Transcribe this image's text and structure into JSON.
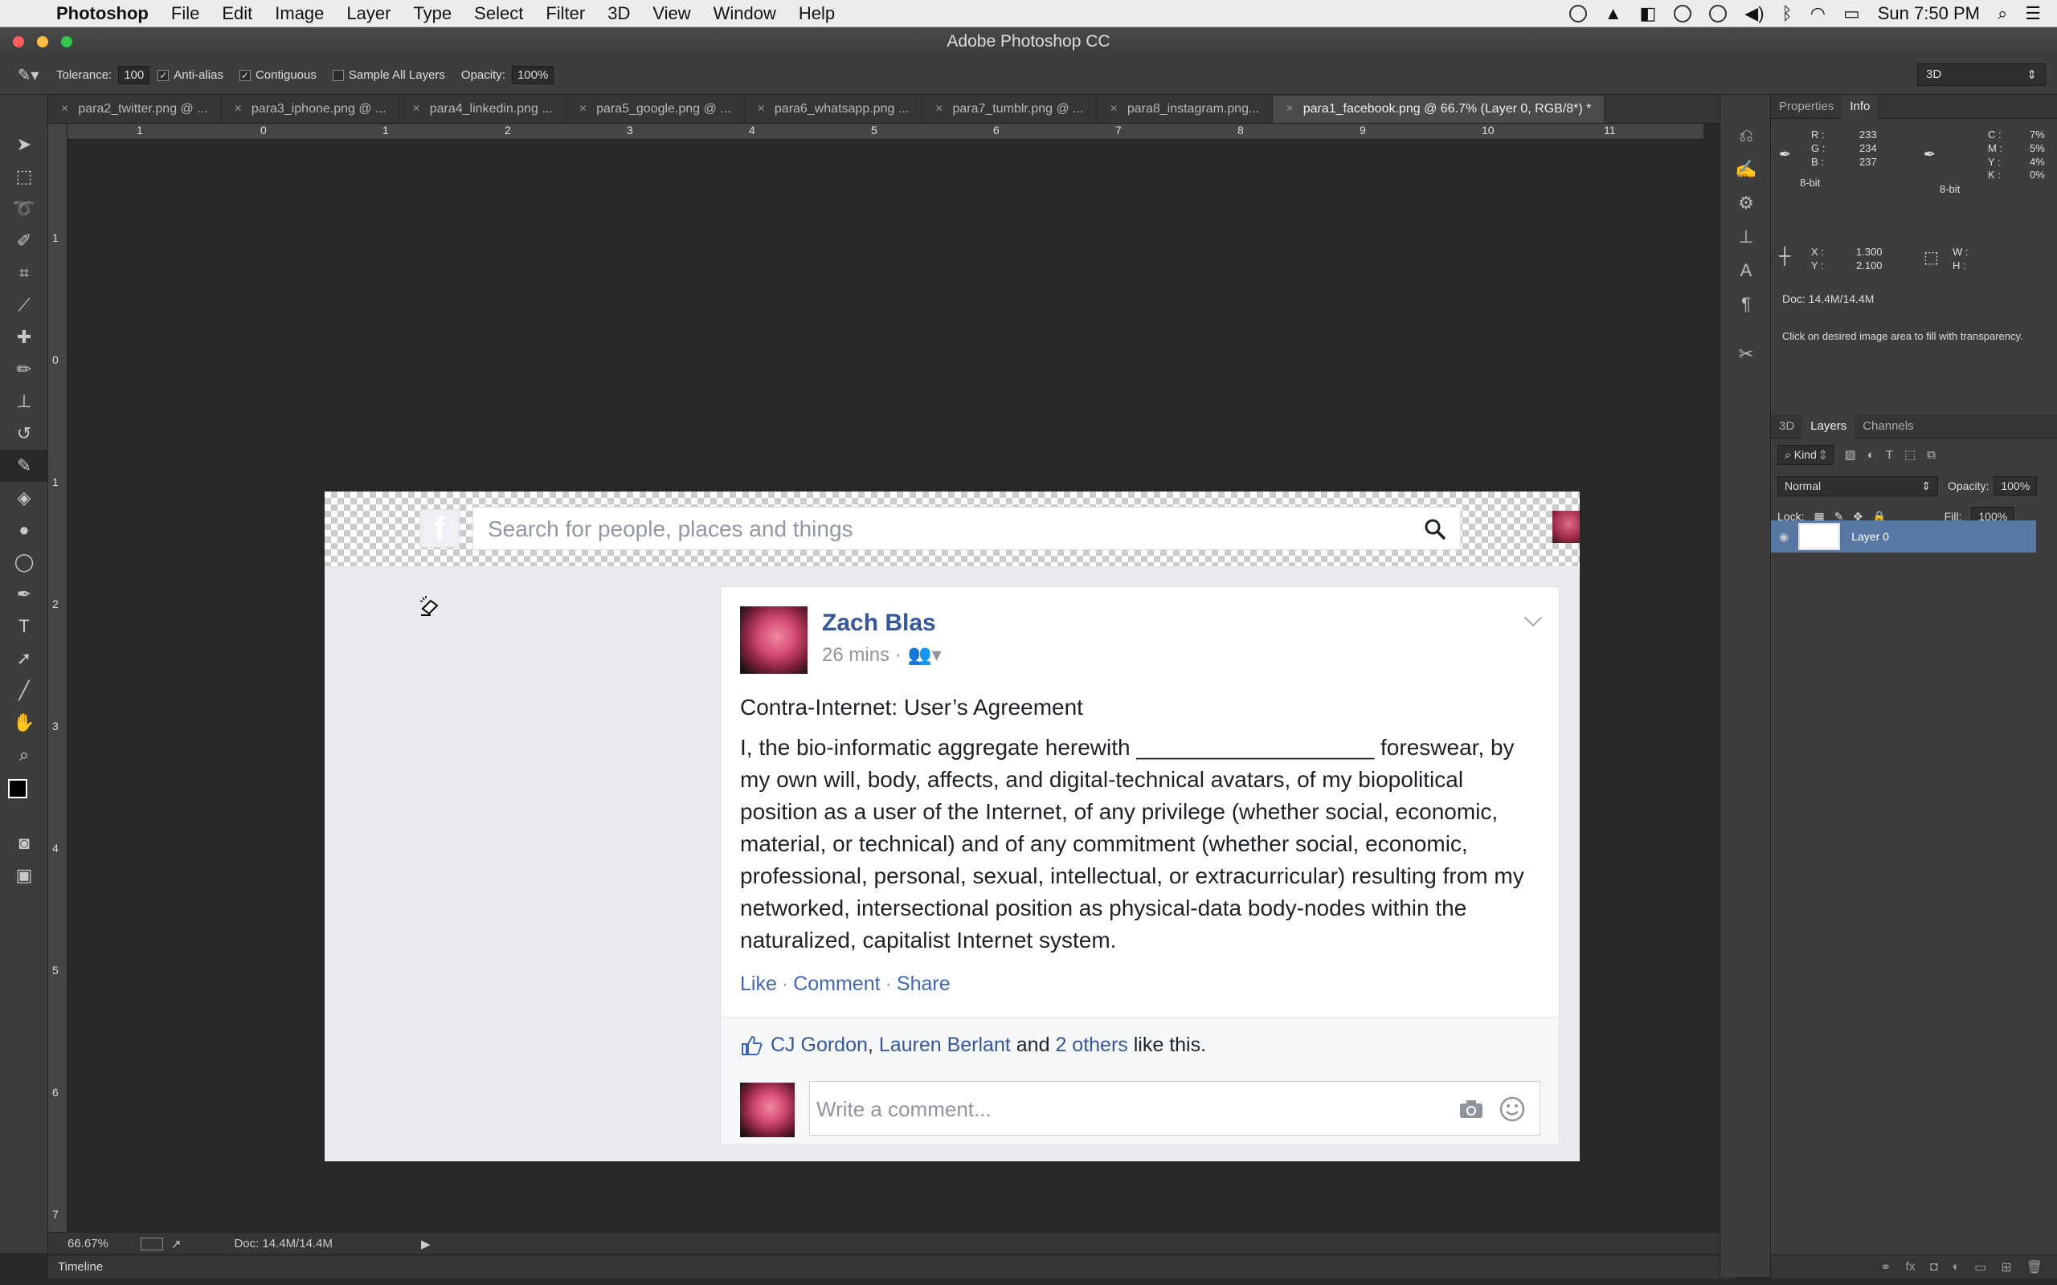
{
  "menubar": {
    "app": "Photoshop",
    "items": [
      "File",
      "Edit",
      "Image",
      "Layer",
      "Type",
      "Select",
      "Filter",
      "3D",
      "View",
      "Window",
      "Help"
    ],
    "clock": "Sun 7:50 PM"
  },
  "window": {
    "title": "Adobe Photoshop CC"
  },
  "options": {
    "tolerance_label": "Tolerance:",
    "tolerance": "100",
    "antialias": "Anti-alias",
    "contiguous": "Contiguous",
    "sample_all": "Sample All Layers",
    "opacity_label": "Opacity:",
    "opacity": "100%",
    "workspace": "3D"
  },
  "tabs": [
    "para2_twitter.png @ ...",
    "para3_iphone.png @ ...",
    "para4_linkedin.png ...",
    "para5_google.png @ ...",
    "para6_whatsapp.png ...",
    "para7_tumblr.png @ ...",
    "para8_instagram.png...",
    "para1_facebook.png @ 66.7% (Layer 0, RGB/8*) *"
  ],
  "ruler": {
    "h": [
      "0",
      "1",
      "2",
      "3",
      "4",
      "5",
      "6",
      "7",
      "8",
      "9",
      "10",
      "11"
    ],
    "v": [
      "1",
      "0",
      "1",
      "2",
      "3",
      "4",
      "5",
      "6",
      "7"
    ],
    "h_first": "1"
  },
  "fb": {
    "search_placeholder": "Search for people, places and things",
    "author": "Zach Blas",
    "time": "26 mins ·",
    "title": "Contra-Internet: User’s Agreement",
    "body": "I, the bio-informatic aggregate herewith ___________________ foreswear, by my own will, body, affects, and digital-technical avatars, of my biopolitical position as a user of the Internet, of any privilege (whether social, economic, material, or technical) and of any commitment (whether social, economic, professional, personal, sexual, intellectual, or extracurricular) resulting from my networked, intersectional position as physical-data body-nodes within the naturalized, capitalist Internet system.",
    "actions": [
      "Like",
      "Comment",
      "Share"
    ],
    "likers": [
      "CJ Gordon",
      "Lauren Berlant"
    ],
    "likes_and": "and",
    "likes_others": "2 others",
    "likes_tail": "like this.",
    "comment_placeholder": "Write a comment..."
  },
  "status": {
    "zoom": "66.67%",
    "doc": "Doc: 14.4M/14.4M"
  },
  "timeline": "Timeline",
  "info": {
    "tabs": [
      "Properties",
      "Info"
    ],
    "r": "233",
    "g": "234",
    "b": "237",
    "bit1": "8-bit",
    "c": "7%",
    "m": "5%",
    "y": "4%",
    "k": "0%",
    "bit2": "8-bit",
    "x": "1.300",
    "yv": "2.100",
    "doc": "Doc: 14.4M/14.4M",
    "hint": "Click on desired image area to fill with transparency.",
    "labels": {
      "r": "R :",
      "g": "G :",
      "b": "B :",
      "c": "C :",
      "m": "M :",
      "y": "Y :",
      "k": "K :",
      "x": "X :",
      "yy": "Y :",
      "w": "W :",
      "h": "H :"
    }
  },
  "layers": {
    "tabs": [
      "3D",
      "Layers",
      "Channels"
    ],
    "kind": "Kind",
    "blend": "Normal",
    "opacity_label": "Opacity:",
    "opacity": "100%",
    "lock_label": "Lock:",
    "fill_label": "Fill:",
    "fill": "100%",
    "layer_name": "Layer 0"
  }
}
